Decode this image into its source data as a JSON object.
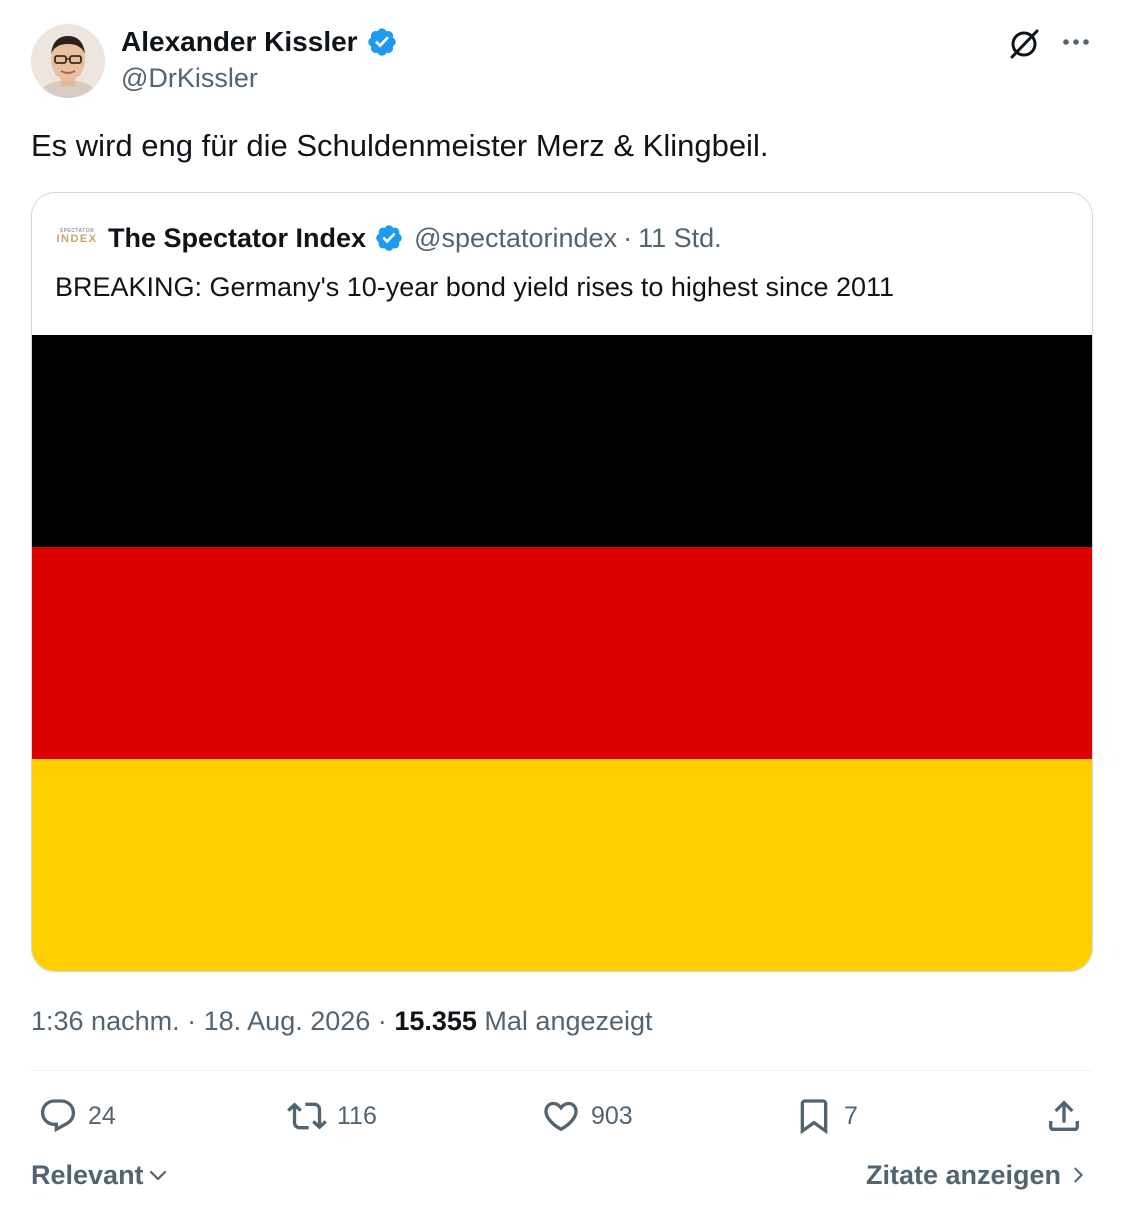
{
  "author": {
    "name": "Alexander Kissler",
    "handle": "@DrKissler"
  },
  "tweet": {
    "text": "Es wird eng für die Schuldenmeister Merz & Klingbeil."
  },
  "quoted": {
    "logo_small": "SPECTATOR",
    "logo_big": "INDEX",
    "name": "The Spectator Index",
    "handle": "@spectatorindex",
    "separator": "·",
    "time": "11 Std.",
    "text": "BREAKING: Germany's 10-year bond yield rises to highest since 2011",
    "flag_colors": [
      "#000000",
      "#dd0000",
      "#ffce00"
    ]
  },
  "meta": {
    "time": "1:36 nachm.",
    "sep1": "·",
    "date": "18. Aug. 2026",
    "sep2": "·",
    "views_count": "15.355",
    "views_label": "Mal angezeigt"
  },
  "actions": {
    "replies": "24",
    "retweets": "116",
    "likes": "903",
    "bookmarks": "7"
  },
  "footer": {
    "sort_label": "Relevant",
    "quotes_label": "Zitate anzeigen"
  },
  "colors": {
    "text_primary": "#0f1419",
    "text_secondary": "#536471",
    "verified_blue": "#1d9bf0"
  },
  "icons": [
    "verified-badge-icon",
    "grok-icon",
    "more-icon",
    "reply-icon",
    "retweet-icon",
    "like-icon",
    "bookmark-icon",
    "share-icon",
    "chevron-down-icon",
    "chevron-right-icon"
  ]
}
